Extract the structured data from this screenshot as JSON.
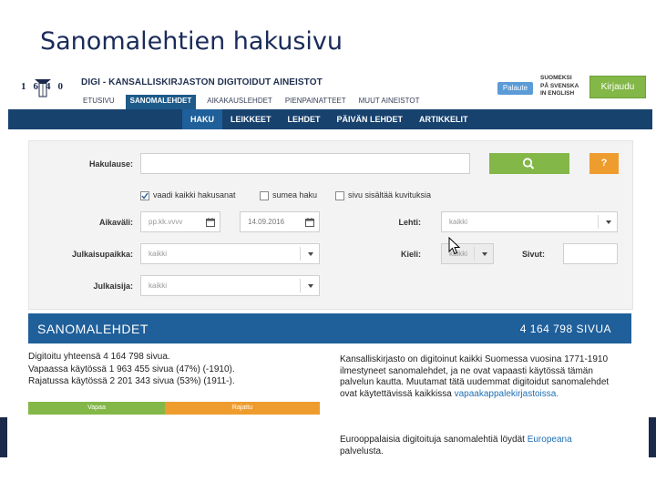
{
  "slide_title": "Sanomalehtien hakusivu",
  "logo": {
    "text": "1640"
  },
  "header": {
    "site_title": "DIGI - KANSALLISKIRJASTON DIGITOIDUT AINEISTOT",
    "nav": [
      {
        "label": "ETUSIVU",
        "active": false
      },
      {
        "label": "SANOMALEHDET",
        "active": true
      },
      {
        "label": "AIKAKAUSLEHDET",
        "active": false
      },
      {
        "label": "PIENPAINATTEET",
        "active": false
      },
      {
        "label": "MUUT AINEISTOT",
        "active": false
      }
    ],
    "feedback_label": "Palaute",
    "languages": [
      "SUOMEKSI",
      "PÅ SVENSKA",
      "IN ENGLISH"
    ],
    "login_label": "Kirjaudu"
  },
  "subnav": [
    {
      "label": "HAKU",
      "active": true
    },
    {
      "label": "LEIKKEET",
      "active": false
    },
    {
      "label": "LEHDET",
      "active": false
    },
    {
      "label": "PÄIVÄN LEHDET",
      "active": false
    },
    {
      "label": "ARTIKKELIT",
      "active": false
    }
  ],
  "search_form": {
    "query_label": "Hakulause:",
    "query_value": "",
    "help_label": "?",
    "checkboxes": [
      {
        "label": "vaadi kaikki hakusanat",
        "checked": true
      },
      {
        "label": "sumea haku",
        "checked": false
      },
      {
        "label": "sivu sisältää kuvituksia",
        "checked": false
      }
    ],
    "date_label": "Aikaväli:",
    "date_from_placeholder": "pp.kk.vvvv",
    "date_to_value": "14.09.2016",
    "newspaper_label": "Lehti:",
    "newspaper_value": "kaikki",
    "place_label": "Julkaisupaikka:",
    "place_value": "kaikki",
    "language_label": "Kieli:",
    "language_value": "kaikki",
    "pages_label": "Sivut:",
    "pages_value": "",
    "publisher_label": "Julkaisija:",
    "publisher_value": "kaikki"
  },
  "banner": {
    "title": "SANOMALEHDET",
    "count": "4 164 798  SIVUA"
  },
  "stats": {
    "line1": "Digitoitu yhteensä  4 164 798  sivua.",
    "line2": "Vapaassa käytössä  1 963 455  sivua (47%) (-1910).",
    "line3": "Rajatussa käytössä  2 201 343  sivua (53%) (1911-).",
    "open_fraction": 0.47,
    "open_label": "Vapaa",
    "restricted_label": "Rajattu"
  },
  "info": {
    "text": "Kansalliskirjasto on digitoinut kaikki Suomessa vuosina 1771-1910 ilmestyneet sanomalehdet, ja ne ovat vapaasti käytössä tämän palvelun kautta. Muutamat tätä uudemmat digitoidut sanomalehdet ovat käytettävissä kaikkissa",
    "link": "vapaakappalekirjastoissa.",
    "europeana_text": "Eurooppalaisia digitoituja sanomalehtiä löydät",
    "europeana_link": "Europeana",
    "europeana_suffix": "palvelusta."
  },
  "colors": {
    "navy": "#17426e",
    "blue": "#1f5f9a",
    "green": "#83b747",
    "orange": "#ef9c2e",
    "title": "#1a2b5a"
  },
  "icons": {
    "search": "search-icon",
    "calendar": "calendar-icon",
    "cursor": "mouse-cursor-icon"
  }
}
